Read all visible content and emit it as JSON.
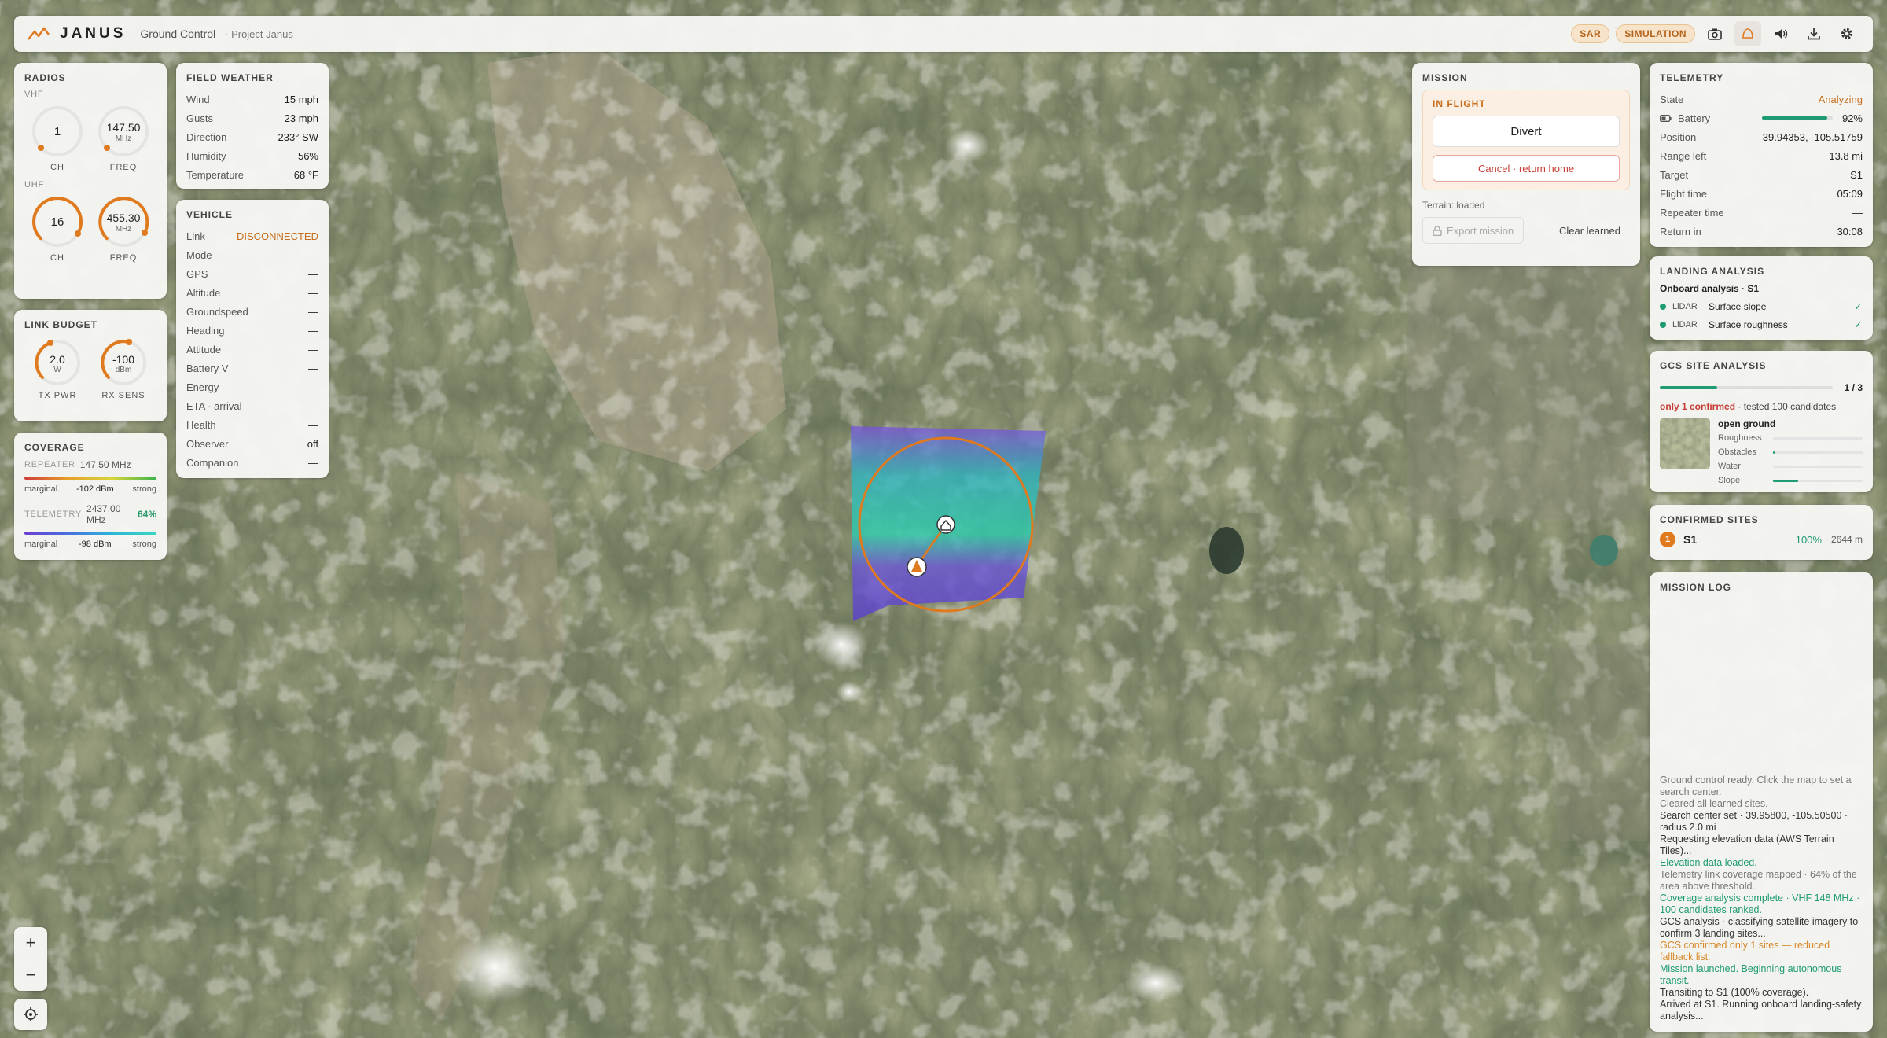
{
  "topbar": {
    "brand": "JANUS",
    "app_name": "Ground Control",
    "project": "· Project Janus",
    "badges": [
      "SAR",
      "SIMULATION"
    ],
    "icons": [
      "camera-icon",
      "terrain-icon",
      "speaker-icon",
      "download-icon",
      "gear-icon"
    ]
  },
  "radios": {
    "title": "RADIOS",
    "vhf_label": "VHF",
    "vhf_ch": "1",
    "vhf_freq": "147.50",
    "vhf_freq_unit": "MHz",
    "uhf_label": "UHF",
    "uhf_ch": "16",
    "uhf_freq": "455.30",
    "uhf_freq_unit": "MHz",
    "ch_caption": "CH",
    "freq_caption": "FREQ"
  },
  "link_budget": {
    "title": "LINK BUDGET",
    "tx_value": "2.0",
    "tx_unit": "W",
    "tx_caption": "TX PWR",
    "rx_value": "-100",
    "rx_unit": "dBm",
    "rx_caption": "RX SENS"
  },
  "coverage": {
    "title": "COVERAGE",
    "repeater_label": "REPEATER",
    "repeater_freq": "147.50 MHz",
    "repeater_marginal": "marginal",
    "repeater_dbm": "-102 dBm",
    "repeater_strong": "strong",
    "telemetry_label": "TELEMETRY",
    "telemetry_freq": "2437.00 MHz",
    "telemetry_pct": "64%",
    "telemetry_marginal": "marginal",
    "telemetry_dbm": "-98 dBm",
    "telemetry_strong": "strong"
  },
  "weather": {
    "title": "FIELD WEATHER",
    "rows": [
      {
        "k": "Wind",
        "v": "15 mph"
      },
      {
        "k": "Gusts",
        "v": "23 mph"
      },
      {
        "k": "Direction",
        "v": "233° SW"
      },
      {
        "k": "Humidity",
        "v": "56%"
      },
      {
        "k": "Temperature",
        "v": "68 °F"
      }
    ]
  },
  "vehicle": {
    "title": "VEHICLE",
    "rows": [
      {
        "k": "Link",
        "v": "DISCONNECTED"
      },
      {
        "k": "Mode",
        "v": "—"
      },
      {
        "k": "GPS",
        "v": "—"
      },
      {
        "k": "Altitude",
        "v": "—"
      },
      {
        "k": "Groundspeed",
        "v": "—"
      },
      {
        "k": "Heading",
        "v": "—"
      },
      {
        "k": "Attitude",
        "v": "—"
      },
      {
        "k": "Battery V",
        "v": "—"
      },
      {
        "k": "Energy",
        "v": "—"
      },
      {
        "k": "ETA · arrival",
        "v": "—"
      },
      {
        "k": "Health",
        "v": "—"
      },
      {
        "k": "Observer",
        "v": "off"
      },
      {
        "k": "Companion",
        "v": "—"
      }
    ]
  },
  "mission": {
    "title": "MISSION",
    "state": "IN FLIGHT",
    "divert_label": "Divert",
    "cancel_label": "Cancel · return home",
    "terrain": "Terrain: loaded",
    "export_label": "Export mission",
    "clear_label": "Clear learned"
  },
  "telemetry": {
    "title": "TELEMETRY",
    "state_label": "State",
    "state_value": "Analyzing",
    "battery_label": "Battery",
    "battery_value": "92%",
    "battery_fraction": 0.92,
    "rows": [
      {
        "k": "Position",
        "v": "39.94353, -105.51759"
      },
      {
        "k": "Range left",
        "v": "13.8 mi"
      },
      {
        "k": "Target",
        "v": "S1"
      },
      {
        "k": "Flight time",
        "v": "05:09"
      },
      {
        "k": "Repeater time",
        "v": "—"
      },
      {
        "k": "Return in",
        "v": "30:08"
      }
    ]
  },
  "landing": {
    "title": "LANDING ANALYSIS",
    "subtitle": "Onboard analysis · S1",
    "rows": [
      {
        "sensor": "LiDAR",
        "label": "Surface slope"
      },
      {
        "sensor": "LiDAR",
        "label": "Surface roughness"
      }
    ]
  },
  "gcs": {
    "title": "GCS SITE ANALYSIS",
    "count": "1 / 3",
    "progress_fraction": 0.333,
    "confirmed_text": "only 1 confirmed",
    "tested_text": "· tested 100 candidates",
    "site_name": "open ground",
    "metrics": [
      {
        "k": "Roughness",
        "frac": 0.0
      },
      {
        "k": "Obstacles",
        "frac": 0.02
      },
      {
        "k": "Water",
        "frac": 0.0
      },
      {
        "k": "Slope",
        "frac": 0.28
      }
    ]
  },
  "confirmed": {
    "title": "CONFIRMED SITES",
    "sites": [
      {
        "num": "1",
        "name": "S1",
        "pct": "100%",
        "dist": "2644 m"
      }
    ]
  },
  "log": {
    "title": "MISSION LOG",
    "lines": [
      {
        "t": "Ground control ready. Click the map to set a search center.",
        "c": "muted"
      },
      {
        "t": "Cleared all learned sites.",
        "c": "muted"
      },
      {
        "t": "Search center set · 39.95800, -105.50500 · radius 2.0 mi",
        "c": "info"
      },
      {
        "t": "Requesting elevation data (AWS Terrain Tiles)...",
        "c": "info"
      },
      {
        "t": "Elevation data loaded.",
        "c": "ok"
      },
      {
        "t": "Telemetry link coverage mapped · 64% of the area above threshold.",
        "c": "muted"
      },
      {
        "t": "Coverage analysis complete · VHF 148 MHz · 100 candidates ranked.",
        "c": "ok"
      },
      {
        "t": "GCS analysis · classifying satellite imagery to confirm 3 landing sites...",
        "c": "info"
      },
      {
        "t": "GCS confirmed only 1 sites — reduced fallback list.",
        "c": "warn"
      },
      {
        "t": "Mission launched. Beginning autonomous transit.",
        "c": "ok"
      },
      {
        "t": "Transiting to S1 (100% coverage).",
        "c": "info"
      },
      {
        "t": "Arrived at S1. Running onboard landing-safety analysis...",
        "c": "info"
      }
    ]
  },
  "map_controls": {
    "zoom_in": "+",
    "zoom_out": "−"
  },
  "colors": {
    "accent": "#e07a1f",
    "ok": "#1e9b73",
    "danger": "#c63c33"
  }
}
